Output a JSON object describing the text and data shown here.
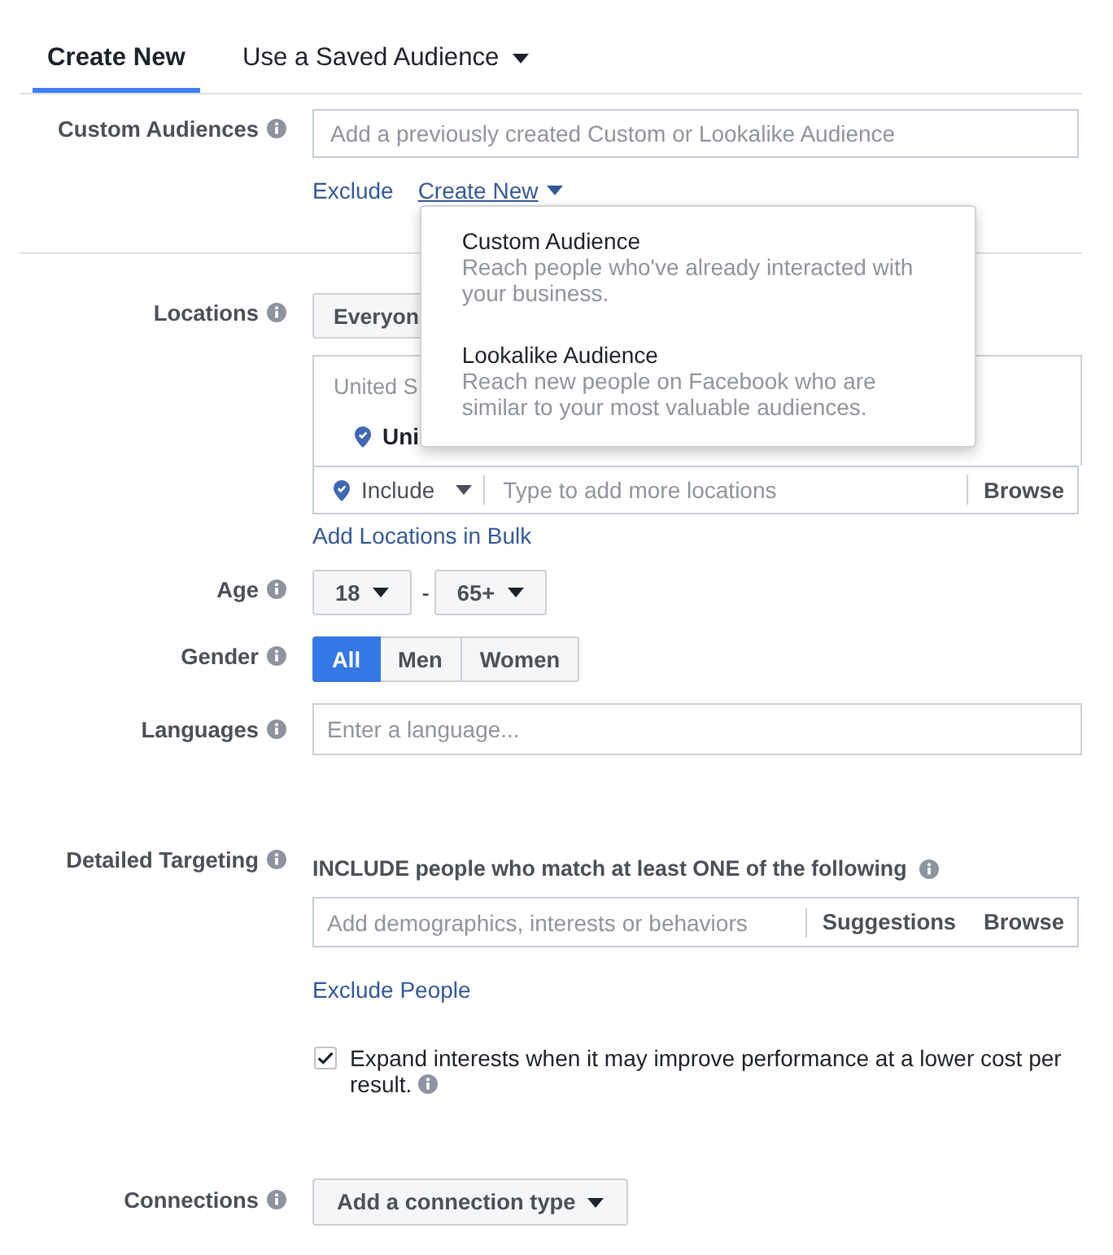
{
  "tabs": [
    {
      "label": "Create New",
      "kind": "plain",
      "selected": true
    },
    {
      "label": "Use a Saved Audience",
      "kind": "dropdown",
      "selected": false
    }
  ],
  "custom_audiences": {
    "label": "Custom Audiences",
    "placeholder": "Add a previously created Custom or Lookalike Audience",
    "links": [
      {
        "label": "Exclude",
        "kind": "plain",
        "expanded": false
      },
      {
        "label": "Create New",
        "kind": "menu",
        "expanded": true,
        "menu": [
          {
            "title": "Custom Audience",
            "description": "Reach people who've already interacted with your business."
          },
          {
            "title": "Lookalike Audience",
            "description": "Reach new people on Facebook who are similar to your most valuable audiences."
          }
        ]
      }
    ]
  },
  "locations": {
    "label": "Locations",
    "audience_button": "Everyon",
    "selected_heading": "United S",
    "selected_location": "Uni",
    "include_mode": "Include",
    "placeholder": "Type to add more locations",
    "browse": "Browse",
    "bulk_link": "Add Locations in Bulk"
  },
  "age": {
    "label": "Age",
    "min": "18",
    "separator": "-",
    "max": "65+"
  },
  "gender": {
    "label": "Gender",
    "options": [
      {
        "label": "All",
        "selected": true
      },
      {
        "label": "Men",
        "selected": false
      },
      {
        "label": "Women",
        "selected": false
      }
    ]
  },
  "languages": {
    "label": "Languages",
    "placeholder": "Enter a language..."
  },
  "detailed_targeting": {
    "label": "Detailed Targeting",
    "heading": "INCLUDE people who match at least ONE of the following",
    "placeholder": "Add demographics, interests or behaviors",
    "actions": [
      "Suggestions",
      "Browse"
    ],
    "exclude_link": "Exclude People",
    "expand": {
      "checked": true,
      "text": "Expand interests when it may improve performance at a lower cost per result."
    }
  },
  "connections": {
    "label": "Connections",
    "button": "Add a connection type"
  }
}
